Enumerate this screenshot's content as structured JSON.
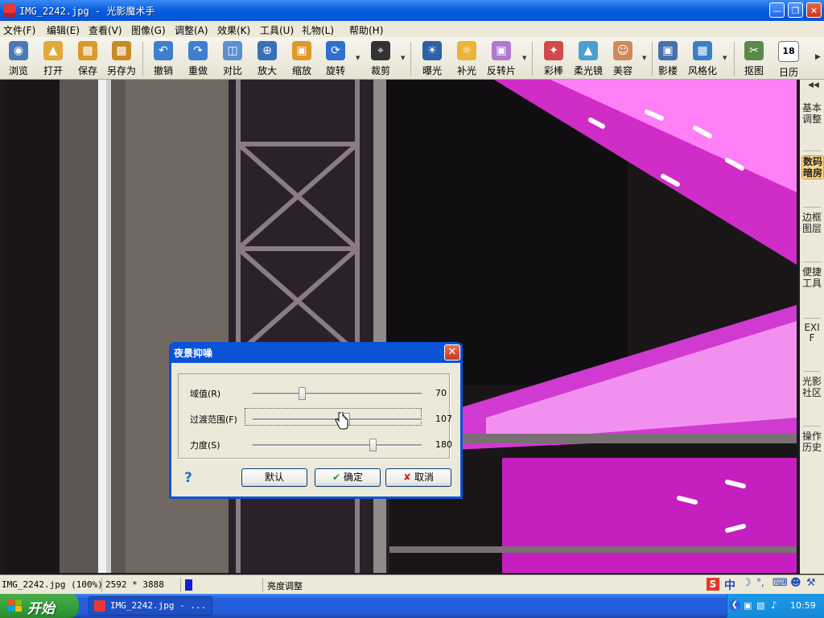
{
  "app": {
    "title": "IMG_2242.jpg - 光影魔术手"
  },
  "menu": {
    "items": [
      "文件(F)",
      "编辑(E)",
      "查看(V)",
      "图像(G)",
      "调整(A)",
      "效果(K)",
      "工具(U)",
      "礼物(L)",
      "帮助(H)"
    ]
  },
  "toolbar": {
    "items": [
      {
        "label": "浏览",
        "icon": "browse-icon",
        "color": "#4b78b8"
      },
      {
        "label": "打开",
        "icon": "open-folder-icon",
        "color": "#e3a93a"
      },
      {
        "label": "保存",
        "icon": "save-icon",
        "color": "#d99a2b"
      },
      {
        "label": "另存为",
        "icon": "save-as-icon",
        "color": "#c98a24"
      },
      {
        "label": "撤销",
        "icon": "undo-icon",
        "color": "#3f7fd0"
      },
      {
        "label": "重做",
        "icon": "redo-icon",
        "color": "#3f7fd0"
      },
      {
        "label": "对比",
        "icon": "compare-icon",
        "color": "#5a8fd0"
      },
      {
        "label": "放大",
        "icon": "zoom-in-icon",
        "color": "#3a6fb8"
      },
      {
        "label": "缩放",
        "icon": "resize-icon",
        "color": "#e0972a"
      },
      {
        "label": "旋转",
        "icon": "rotate-icon",
        "color": "#2f6fd0"
      },
      {
        "label": "裁剪",
        "icon": "crop-icon",
        "color": "#333333"
      },
      {
        "label": "曝光",
        "icon": "exposure-icon",
        "color": "#2f5fa8"
      },
      {
        "label": "补光",
        "icon": "fill-light-icon",
        "color": "#e8b53a"
      },
      {
        "label": "反转片",
        "icon": "reversal-film-icon",
        "color": "#b07ad0"
      },
      {
        "label": "彩棒",
        "icon": "color-wand-icon",
        "color": "#d04a4a"
      },
      {
        "label": "柔光镜",
        "icon": "soft-filter-icon",
        "color": "#4aa0d0"
      },
      {
        "label": "美容",
        "icon": "beauty-icon",
        "color": "#d08a5a"
      },
      {
        "label": "影楼",
        "icon": "studio-icon",
        "color": "#4a70b0"
      },
      {
        "label": "风格化",
        "icon": "stylize-icon",
        "color": "#3a80c8"
      },
      {
        "label": "抠图",
        "icon": "cutout-icon",
        "color": "#5a8a4a"
      },
      {
        "label": "日历",
        "icon": "calendar-icon",
        "color": "#3a8a3a",
        "badge": "18"
      }
    ]
  },
  "side_tabs": {
    "items": [
      {
        "label": "基本调整",
        "active": false
      },
      {
        "label": "数码暗房",
        "active": true
      },
      {
        "label": "边框图层",
        "active": false
      },
      {
        "label": "便捷工具",
        "active": false
      },
      {
        "label": "EXIF",
        "active": false
      },
      {
        "label": "光影社区",
        "active": false
      },
      {
        "label": "操作历史",
        "active": false
      }
    ]
  },
  "dialog": {
    "title": "夜景抑噪",
    "sliders": [
      {
        "label": "域值(R)",
        "value": "70",
        "fraction": 0.29
      },
      {
        "label": "过渡范围(F)",
        "value": "107",
        "fraction": 0.55
      },
      {
        "label": "力度(S)",
        "value": "180",
        "fraction": 0.71
      }
    ],
    "help": "?",
    "buttons": {
      "default": "默认",
      "ok": "确定",
      "cancel": "取消"
    }
  },
  "status": {
    "file": "IMG_2242.jpg (100%)",
    "dimensions": "2592 * 3888",
    "operation": "亮度调整"
  },
  "taskbar": {
    "start": "开始",
    "task_item": "IMG_2242.jpg - ...",
    "clock": "10:59",
    "ime": "中"
  }
}
